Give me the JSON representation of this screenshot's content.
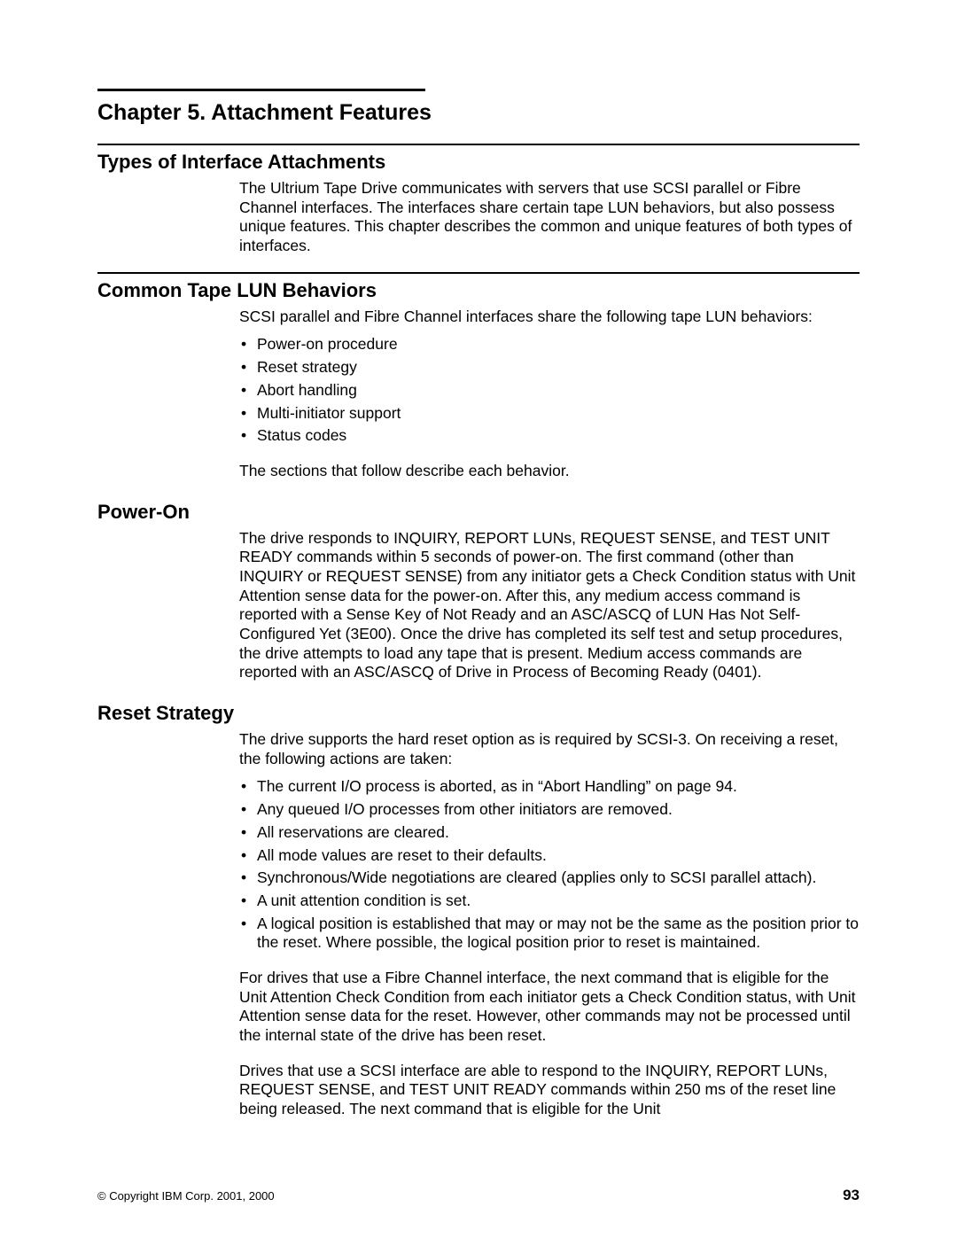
{
  "chapter": {
    "title": "Chapter 5. Attachment Features"
  },
  "section1": {
    "heading": "Types of Interface Attachments",
    "p1": "The Ultrium Tape Drive communicates with servers that use SCSI parallel or Fibre Channel interfaces. The interfaces share certain tape LUN behaviors, but also possess unique features. This chapter describes the common and unique features of both types of interfaces."
  },
  "section2": {
    "heading": "Common Tape LUN Behaviors",
    "p1": "SCSI parallel and Fibre Channel interfaces share the following tape LUN behaviors:",
    "bullets": [
      "Power-on procedure",
      "Reset strategy",
      "Abort handling",
      "Multi-initiator support",
      "Status codes"
    ],
    "p2": "The sections that follow describe each behavior."
  },
  "poweron": {
    "heading": "Power-On",
    "p1": "The drive responds to INQUIRY, REPORT LUNs, REQUEST SENSE, and TEST UNIT READY commands within 5 seconds of power-on. The first command (other than INQUIRY or REQUEST SENSE) from any initiator gets a Check Condition status with Unit Attention sense data for the power-on. After this, any medium access command is reported with a Sense Key of Not Ready and an ASC/ASCQ of LUN Has Not Self-Configured Yet (3E00). Once the drive has completed its self test and setup procedures, the drive attempts to load any tape that is present. Medium access commands are reported with an ASC/ASCQ of Drive in Process of Becoming Ready (0401)."
  },
  "reset": {
    "heading": "Reset Strategy",
    "p1": "The drive supports the hard reset option as is required by SCSI-3. On receiving a reset, the following actions are taken:",
    "bullets": [
      "The current I/O process is aborted, as in “Abort Handling” on page 94.",
      "Any queued I/O processes from other initiators are removed.",
      "All reservations are cleared.",
      "All mode values are reset to their defaults.",
      "Synchronous/Wide negotiations are cleared (applies only to SCSI parallel attach).",
      "A unit attention condition is set.",
      "A logical position is established that may or may not be the same as the position prior to the reset. Where possible, the logical position prior to reset is maintained."
    ],
    "p2": "For drives that use a Fibre Channel interface, the next command that is eligible for the Unit Attention Check Condition from each initiator gets a Check Condition status, with Unit Attention sense data for the reset. However, other commands may not be processed until the internal state of the drive has been reset.",
    "p3": "Drives that use a SCSI interface are able to respond to the INQUIRY, REPORT LUNs, REQUEST SENSE, and TEST UNIT READY commands within 250 ms of the reset line being released. The next command that is eligible for the Unit"
  },
  "footer": {
    "copyright": "© Copyright IBM Corp. 2001, 2000",
    "pagenum": "93"
  }
}
